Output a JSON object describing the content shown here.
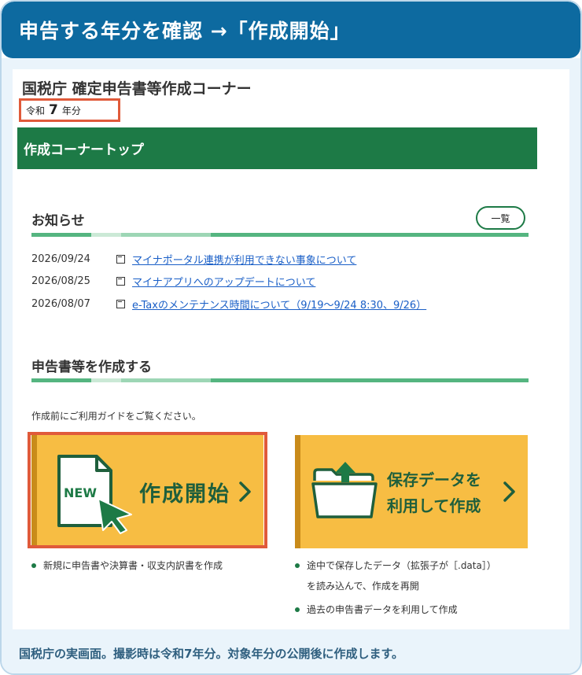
{
  "banner": {
    "title": "申告する年分を確認 →「作成開始」"
  },
  "site": {
    "title": "国税庁 確定申告書等作成コーナー",
    "year_prefix": "令和",
    "year_number": "7",
    "year_suffix": "年分"
  },
  "nav": {
    "top_label": "作成コーナートップ"
  },
  "news": {
    "heading": "お知らせ",
    "more_button": "一覧",
    "items": [
      {
        "date": "2026/09/24",
        "text": "マイナポータル連携が利用できない事象について"
      },
      {
        "date": "2026/08/25",
        "text": "マイナアプリへのアップデートについて"
      },
      {
        "date": "2026/08/07",
        "text": "e-Taxのメンテナンス時間について（9/19〜9/24 8:30、9/26）"
      }
    ]
  },
  "create": {
    "heading": "申告書等を作成する",
    "guide": "作成前にご利用ガイドをご覧ください。",
    "start_card": {
      "badge": "NEW",
      "label": "作成開始"
    },
    "load_card": {
      "label_line1": "保存データを",
      "label_line2": "利用して作成"
    },
    "start_notes": [
      "新規に申告書や決算書・収支内訳書を作成"
    ],
    "load_notes_1a": "途中で保存したデータ（拡張子が［.data］）",
    "load_notes_1b": "を読み込んで、作成を再開",
    "load_notes_2": "過去の申告書データを利用して作成"
  },
  "caption": "国税庁の実画面。撮影時は令和7年分。対象年分の公開後に作成します。",
  "colors": {
    "banner": "#0d6aa0",
    "green": "#1d7a46",
    "card": "#f7bd43",
    "highlight": "#e05a3a",
    "link": "#1a5fc7"
  }
}
